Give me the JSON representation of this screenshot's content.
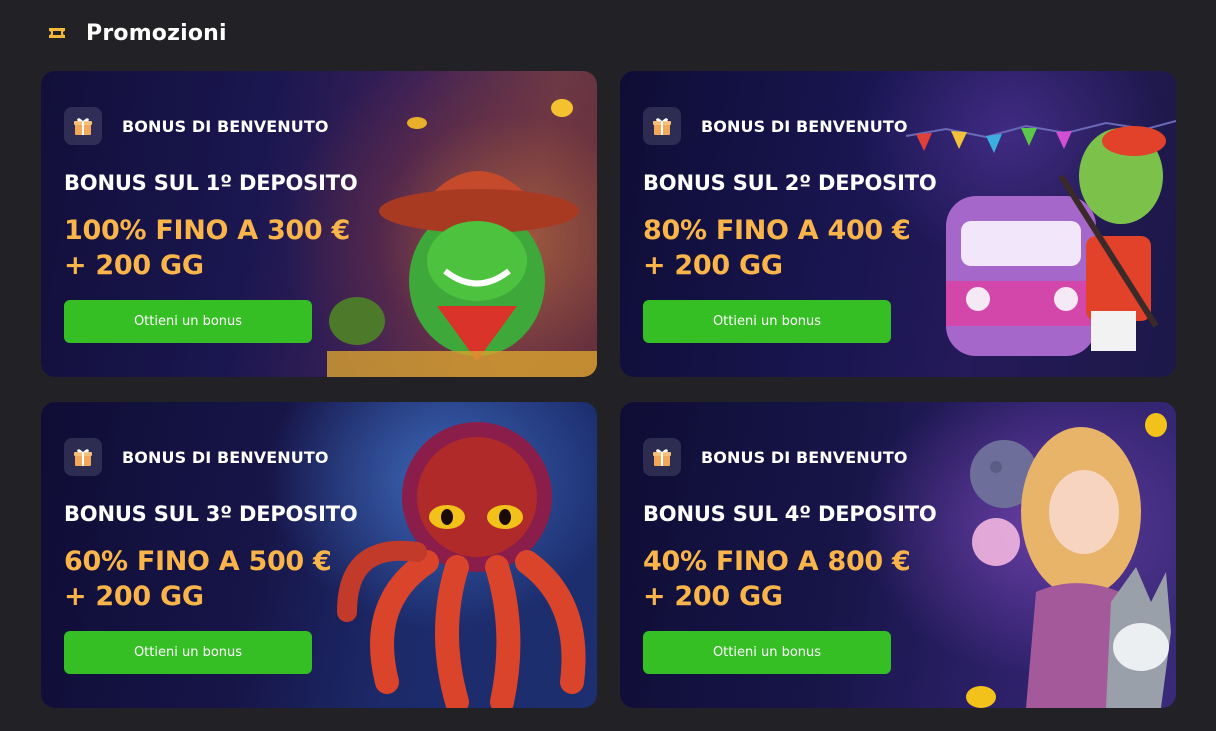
{
  "header": {
    "title": "Promozioni",
    "icon": "ticket-icon"
  },
  "colors": {
    "accent_green": "#36be25",
    "offer_orange": "#f9b54a",
    "background": "#222226"
  },
  "promotions": [
    {
      "badge": "BONUS DI BENVENUTO",
      "title": "BONUS SUL 1º DEPOSITO",
      "offer_line1": "100% FINO A 300 €",
      "offer_line2": "+ 200 GG",
      "button": "Ottieni un bonus",
      "art": "cowboy-cactus-illustration"
    },
    {
      "badge": "BONUS DI BENVENUTO",
      "title": "BONUS SUL 2º DEPOSITO",
      "offer_line1": "80% FINO A 400 €",
      "offer_line2": "+ 200 GG",
      "button": "Ottieni un bonus",
      "art": "frog-guitar-van-illustration"
    },
    {
      "badge": "BONUS DI BENVENUTO",
      "title": "BONUS SUL 3º DEPOSITO",
      "offer_line1": "60% FINO A 500 €",
      "offer_line2": "+ 200 GG",
      "button": "Ottieni un bonus",
      "art": "octopus-illustration"
    },
    {
      "badge": "BONUS DI BENVENUTO",
      "title": "BONUS SUL 4º DEPOSITO",
      "offer_line1": "40% FINO A 800 €",
      "offer_line2": "+ 200 GG",
      "button": "Ottieni un bonus",
      "art": "princess-wolf-illustration"
    }
  ]
}
